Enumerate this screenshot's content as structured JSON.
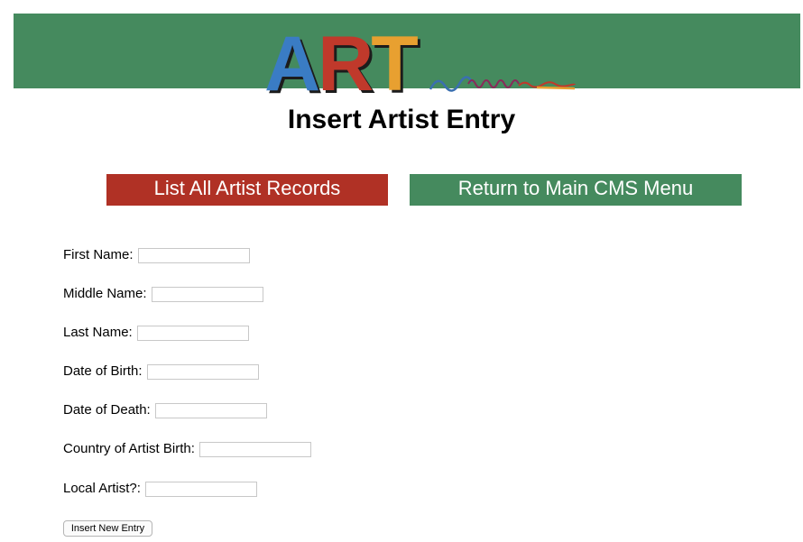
{
  "logo": {
    "letters": [
      "A",
      "R",
      "T"
    ],
    "colors": [
      "#3a7cc4",
      "#c0392b",
      "#e8a030"
    ]
  },
  "banner_color": "#458a5e",
  "page": {
    "title": "Insert Artist Entry"
  },
  "nav": {
    "list_records": "List All Artist Records",
    "return_menu": "Return to Main CMS Menu"
  },
  "form": {
    "fields": [
      {
        "label": "First Name:",
        "value": ""
      },
      {
        "label": "Middle Name:",
        "value": ""
      },
      {
        "label": "Last Name:",
        "value": ""
      },
      {
        "label": "Date of Birth:",
        "value": ""
      },
      {
        "label": "Date of Death:",
        "value": ""
      },
      {
        "label": "Country of Artist Birth:",
        "value": ""
      },
      {
        "label": "Local Artist?:",
        "value": ""
      }
    ],
    "submit_label": "Insert New Entry"
  }
}
